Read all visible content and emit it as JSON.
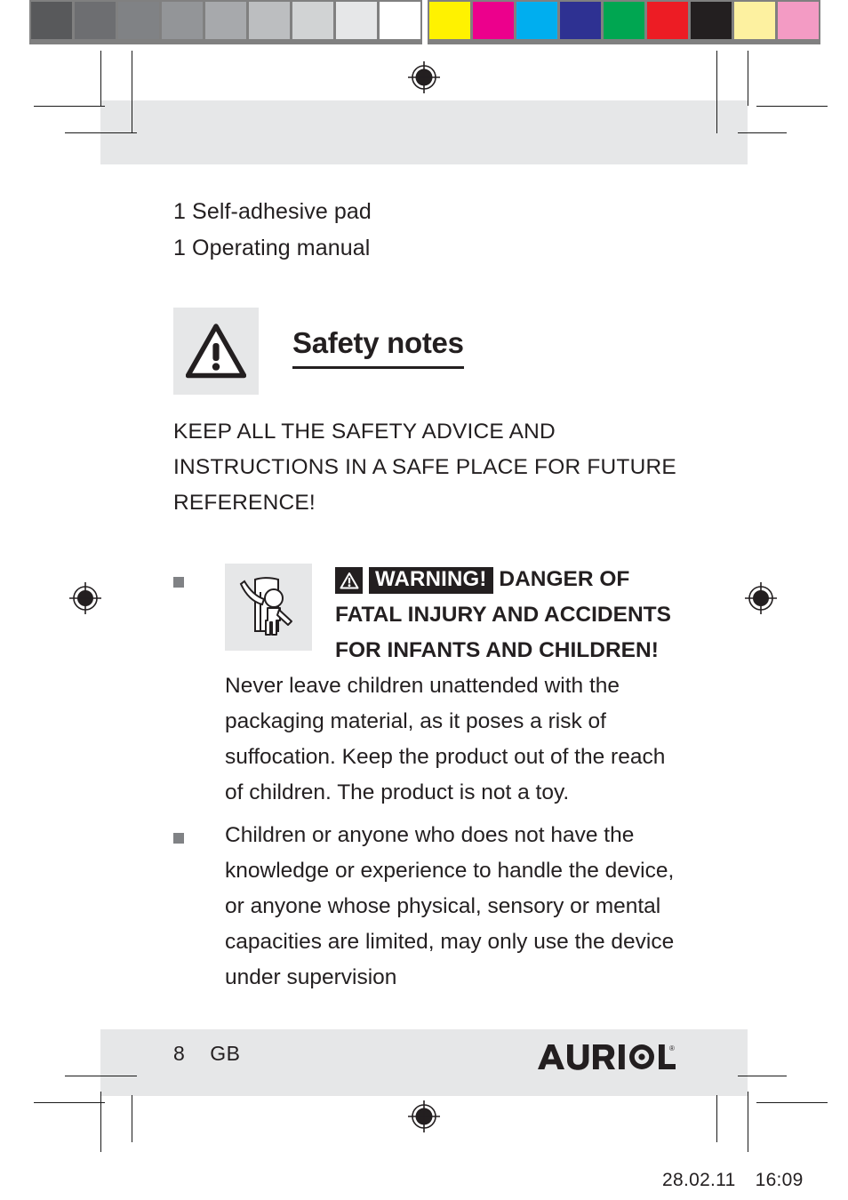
{
  "document": {
    "page_number": "8",
    "language_code": "GB",
    "brand": "AURIOL",
    "brand_registered_mark": "®",
    "timestamp_date": "28.02.11",
    "timestamp_time": "16:09"
  },
  "calibration": {
    "grayscale_label": "grayscale-calibration-bar",
    "grayscale_swatches": [
      "#58595b",
      "#6d6e71",
      "#808285",
      "#939598",
      "#a7a9ac",
      "#bcbec0",
      "#d1d3d4",
      "#e6e7e8",
      "#ffffff"
    ],
    "color_label": "color-calibration-bar",
    "color_swatches": [
      "#fff200",
      "#ec008c",
      "#00aeef",
      "#2e3192",
      "#00a651",
      "#ed1c24",
      "#231f20",
      "#fdf1a0",
      "#f39bc4"
    ],
    "bar_background": "#808080"
  },
  "content": {
    "package_contents": [
      "1 Self-adhesive pad",
      "1 Operating manual"
    ],
    "section": {
      "icon": "warning-triangle-icon",
      "title": "Safety notes"
    },
    "keep_notice": "KEEP ALL THE SAFETY ADVICE AND INSTRUCTIONS IN A SAFE PLACE FOR FUTURE REFERENCE!",
    "bullets": [
      {
        "icon": "child-with-plastic-film-icon",
        "badge_icon": "warning-triangle-icon",
        "badge_word": "WARNING!",
        "headline": " DANGER OF FATAL INJURY AND ACCIDENTS FOR INFANTS AND CHILDREN!",
        "body": " Never leave children unattended with the packaging material, as it poses a risk of suffocation. Keep the product out of the reach of children. The product is not a toy."
      },
      {
        "body": "Children or anyone who does not have the knowledge or experience to handle the device, or anyone whose physical, sensory or mental capacities are limited, may only use the device under supervision"
      }
    ]
  },
  "colors": {
    "text": "#231f20",
    "tile_background": "#e6e7e8",
    "bullet_square": "#808285",
    "band": "#e6e7e8"
  }
}
